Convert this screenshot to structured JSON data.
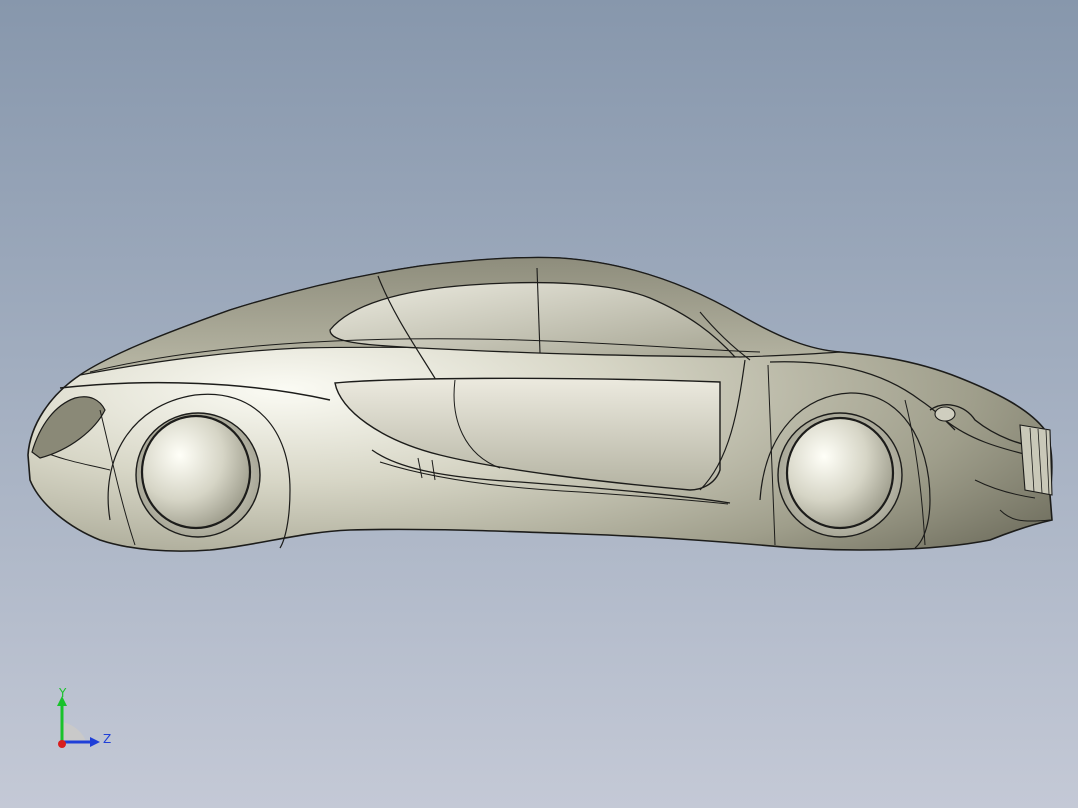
{
  "viewport": {
    "background_top": "#8797ac",
    "background_bottom": "#c4c9d6"
  },
  "model": {
    "body_color": "#8b8a78",
    "edge_color": "#1c1c1a"
  },
  "triad": {
    "y_label": "Y",
    "z_label": "Z",
    "y_color": "#19c22b",
    "z_color": "#1f3fd8",
    "x_color": "#d81e1e"
  }
}
